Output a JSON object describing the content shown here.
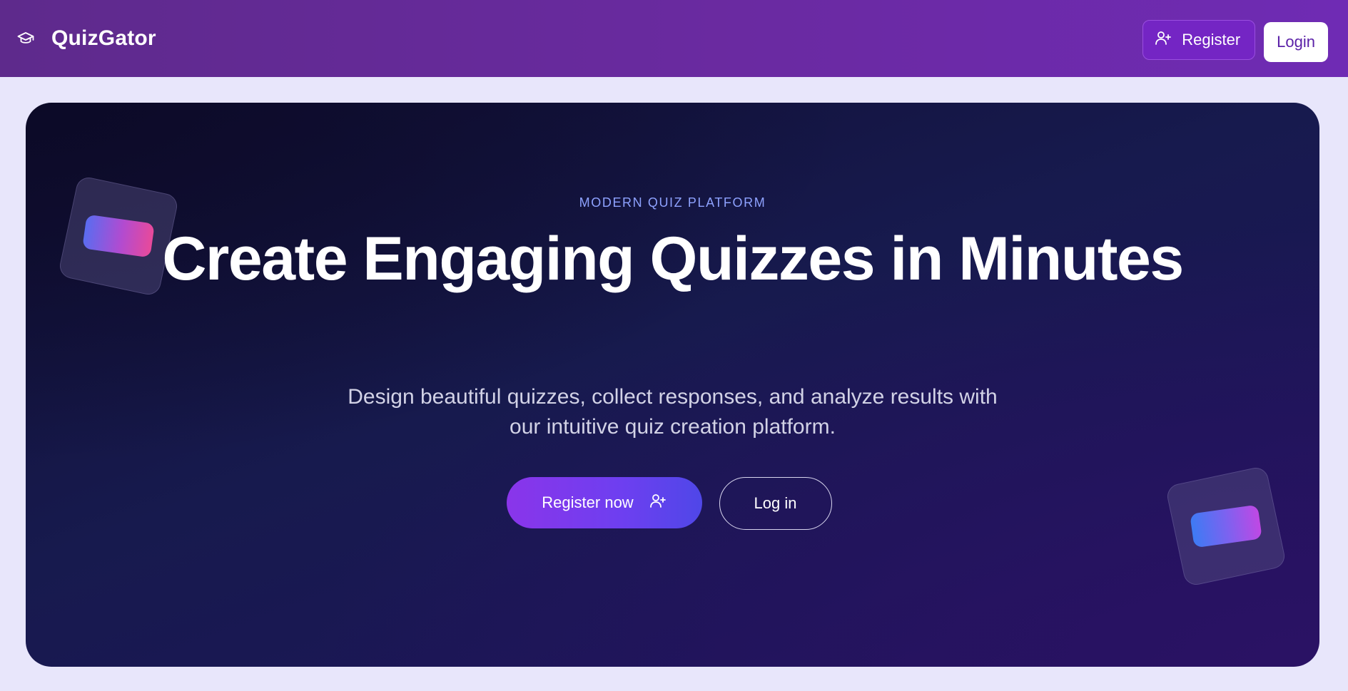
{
  "header": {
    "brand_name": "QuizGator",
    "brand_icon": "graduation-cap-icon",
    "register_label": "Register",
    "register_icon": "user-plus-icon",
    "login_label": "Login"
  },
  "hero": {
    "eyebrow": "MODERN QUIZ PLATFORM",
    "headline": "Create Engaging Quizzes in Minutes",
    "subtitle_line1": "Design beautiful quizzes, collect responses, and analyze results with",
    "subtitle_line2": "our intuitive quiz creation platform.",
    "primary_cta": "Register now",
    "primary_cta_icon": "user-plus-icon",
    "secondary_cta": "Log in"
  },
  "colors": {
    "navbar": "#6a2aa1",
    "page_background": "#e8e6fb",
    "hero_background": "#171a4e",
    "accent": "#8a35ea",
    "eyebrow": "#8ea2ff"
  }
}
